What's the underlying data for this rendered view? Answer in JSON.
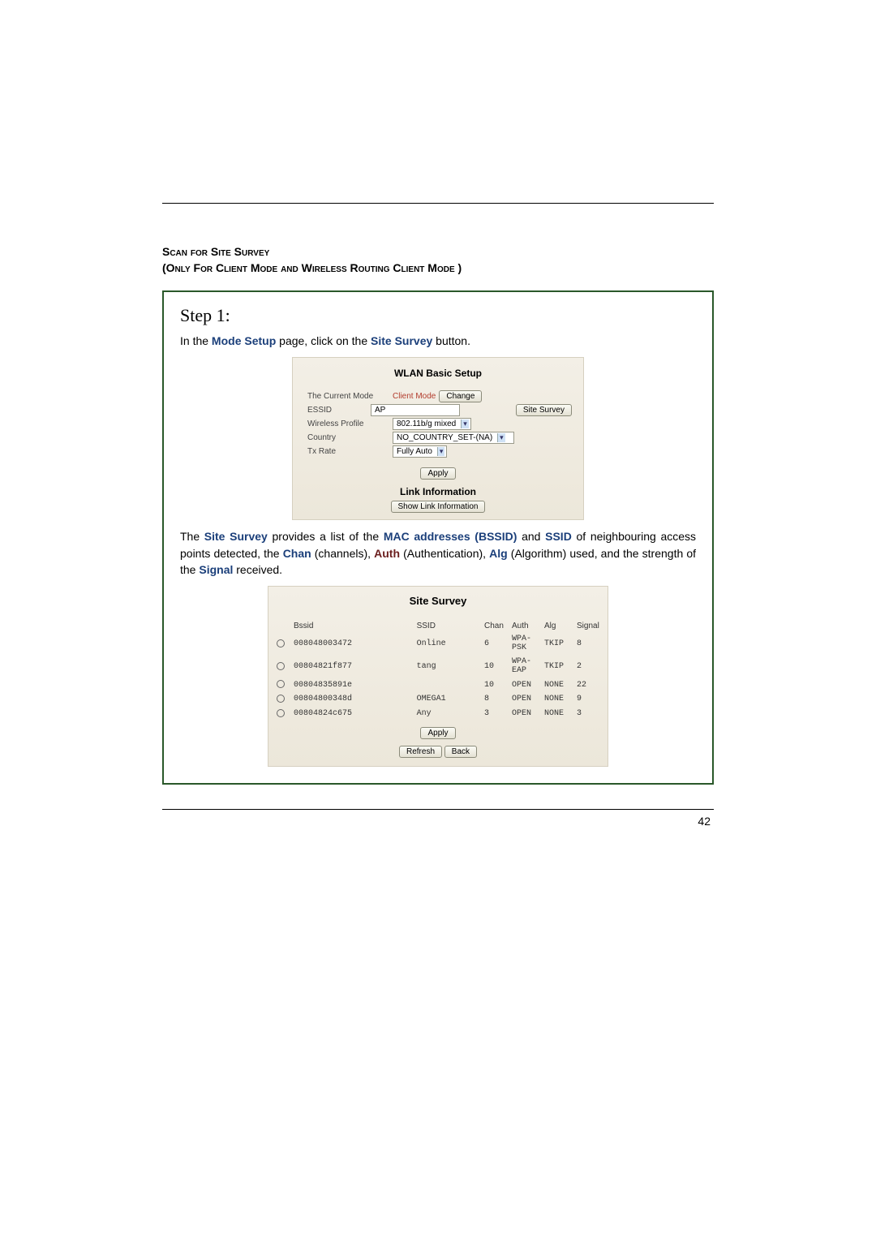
{
  "page_number": "42",
  "heading": {
    "line1": "Scan for Site Survey",
    "line2": "(Only For Client Mode and Wireless Routing Client Mode )"
  },
  "step_label": "Step 1:",
  "intro": {
    "p1_pre": "In the ",
    "p1_kw1": "Mode Setup",
    "p1_mid": " page, click on the ",
    "p1_kw2": "Site Survey",
    "p1_post": " button."
  },
  "wlan": {
    "title": "WLAN Basic Setup",
    "current_mode_label": "The Current Mode",
    "current_mode_value": "Client Mode",
    "change_btn": "Change",
    "essid_label": "ESSID",
    "essid_value": "AP",
    "site_survey_btn": "Site Survey",
    "wprofile_label": "Wireless Profile",
    "wprofile_value": "802.11b/g mixed",
    "country_label": "Country",
    "country_value": "NO_COUNTRY_SET-(NA)",
    "txrate_label": "Tx Rate",
    "txrate_value": "Fully Auto",
    "apply_btn": "Apply",
    "link_info_title": "Link Information",
    "show_link_btn": "Show Link Information"
  },
  "desc": {
    "t1": "The ",
    "kw_ss": "Site Survey",
    "t2": " provides a list of the ",
    "kw_mac": "MAC addresses (BSSID)",
    "t3": " and ",
    "kw_ssid": "SSID",
    "t4": " of neighbouring access points detected, the ",
    "kw_chan": "Chan",
    "t5": " (channels), ",
    "kw_auth": "Auth",
    "t6": " (Authentication), ",
    "kw_alg": "Alg",
    "t7": " (Algorithm) used, and the strength of the ",
    "kw_signal": "Signal",
    "t8": " received."
  },
  "survey": {
    "title": "Site Survey",
    "headers": {
      "bssid": "Bssid",
      "ssid": "SSID",
      "chan": "Chan",
      "auth": "Auth",
      "alg": "Alg",
      "signal": "Signal"
    },
    "rows": [
      {
        "bssid": "008048003472",
        "ssid": "Online",
        "chan": "6",
        "auth": "WPA-PSK",
        "alg": "TKIP",
        "signal": "8"
      },
      {
        "bssid": "00804821f877",
        "ssid": "tang",
        "chan": "10",
        "auth": "WPA-EAP",
        "alg": "TKIP",
        "signal": "2"
      },
      {
        "bssid": "00804835891e",
        "ssid": "",
        "chan": "10",
        "auth": "OPEN",
        "alg": "NONE",
        "signal": "22"
      },
      {
        "bssid": "00804800348d",
        "ssid": "OMEGA1",
        "chan": "8",
        "auth": "OPEN",
        "alg": "NONE",
        "signal": "9"
      },
      {
        "bssid": "00804824c675",
        "ssid": "Any",
        "chan": "3",
        "auth": "OPEN",
        "alg": "NONE",
        "signal": "3"
      }
    ],
    "apply_btn": "Apply",
    "refresh_btn": "Refresh",
    "back_btn": "Back"
  }
}
